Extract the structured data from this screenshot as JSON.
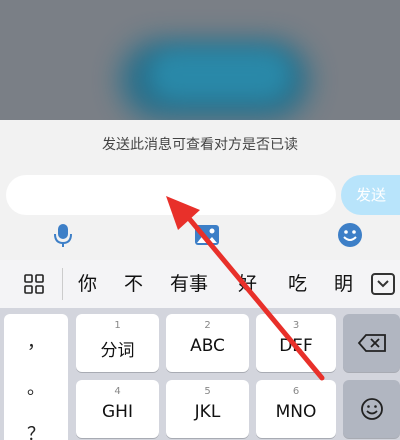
{
  "chat": {
    "read_receipt_hint": "发送此消息可查看对方是否已读",
    "input_value": "",
    "send_label": "发送",
    "tools": [
      "microphone-icon",
      "image-icon",
      "emoji-icon"
    ]
  },
  "candidates": [
    "你",
    "不",
    "有事",
    "好",
    "吃",
    "眀"
  ],
  "keyboard": {
    "punctuation": [
      "，",
      "。",
      "？"
    ],
    "keys": [
      {
        "num": "1",
        "label": "分词"
      },
      {
        "num": "2",
        "label": "ABC"
      },
      {
        "num": "3",
        "label": "DEF"
      },
      {
        "num": "4",
        "label": "GHI"
      },
      {
        "num": "5",
        "label": "JKL"
      },
      {
        "num": "6",
        "label": "MNO"
      }
    ]
  },
  "colors": {
    "send_button": "#b8e4fb",
    "arrow": "#e8302a",
    "accent_icon": "#3d7fc7"
  }
}
